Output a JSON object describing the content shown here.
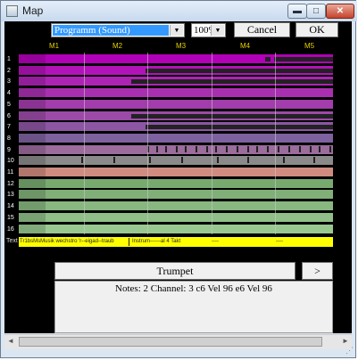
{
  "window": {
    "title": "Map",
    "controls": {
      "minimize": "▬",
      "maximize": "□",
      "close": "✕"
    }
  },
  "toolbar": {
    "program_select": "Programm (Sound)",
    "zoom_select": "100%",
    "cancel_label": "Cancel",
    "ok_label": "OK"
  },
  "measures": [
    "M1",
    "M2",
    "M3",
    "M4",
    "M5"
  ],
  "tracks": [
    {
      "num": "1",
      "color": "#b200b8"
    },
    {
      "num": "2",
      "color": "#b213b8"
    },
    {
      "num": "3",
      "color": "#ad24b4"
    },
    {
      "num": "4",
      "color": "#a830b0"
    },
    {
      "num": "5",
      "color": "#a33cac"
    },
    {
      "num": "6",
      "color": "#9c4aa8"
    },
    {
      "num": "7",
      "color": "#8c56a4"
    },
    {
      "num": "8",
      "color": "#7e62a0"
    },
    {
      "num": "9",
      "color": "#9b6c9c"
    },
    {
      "num": "10",
      "color": "#8a8a8a"
    },
    {
      "num": "11",
      "color": "#d08c80"
    },
    {
      "num": "12",
      "color": "#78aa70"
    },
    {
      "num": "13",
      "color": "#80b078"
    },
    {
      "num": "14",
      "color": "#88b880"
    },
    {
      "num": "15",
      "color": "#90c088"
    },
    {
      "num": "16",
      "color": "#98c890"
    }
  ],
  "text_track": {
    "label": "Text",
    "items": [
      "Tr1bsMsMusik wechstro 'r--eigad--traub",
      "Instrum------al 4 Takt",
      "----",
      "----"
    ]
  },
  "instrument_label": "Trumpet",
  "next_label": ">",
  "notes_text": "Notes: 2 Channel: 3 c6 Vel 96 e6 Vel 96",
  "scrollbar": {
    "left_arrow": "◄",
    "right_arrow": "►"
  },
  "colors": {
    "accent_select": "#3399ff",
    "text_track": "#ffff00",
    "measure_marker": "#e6d000"
  }
}
